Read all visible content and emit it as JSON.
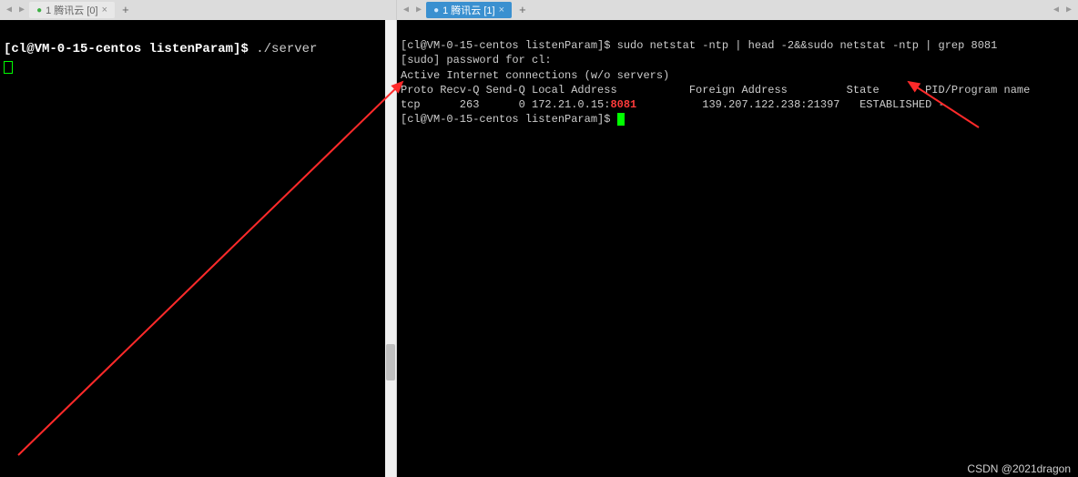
{
  "tabs": {
    "left": {
      "label": "1 腾讯云 [0]",
      "active": false
    },
    "right": {
      "label": "1 腾讯云 [1]",
      "active": true
    }
  },
  "left_term": {
    "prompt": "[cl@VM-0-15-centos listenParam]$ ",
    "cmd": "./server"
  },
  "right_term": {
    "line1_prompt": "[cl@VM-0-15-centos listenParam]$ ",
    "line1_cmd": "sudo netstat -ntp | head -2&&sudo netstat -ntp | grep 8081",
    "line2": "[sudo] password for cl:",
    "line3": "Active Internet connections (w/o servers)",
    "hdr_proto": "Proto Recv-Q Send-Q Local Address           Foreign Address         State       PID/Program name",
    "row_left": "tcp      263      0 172.21.0.15:",
    "row_port": "8081",
    "row_right_foreign": "139.207.122.238:21397",
    "row_right_state": "ESTABLISHED",
    "row_right_prog": "-",
    "line6_prompt": "[cl@VM-0-15-centos listenParam]$ "
  },
  "watermark": "CSDN @2021dragon"
}
